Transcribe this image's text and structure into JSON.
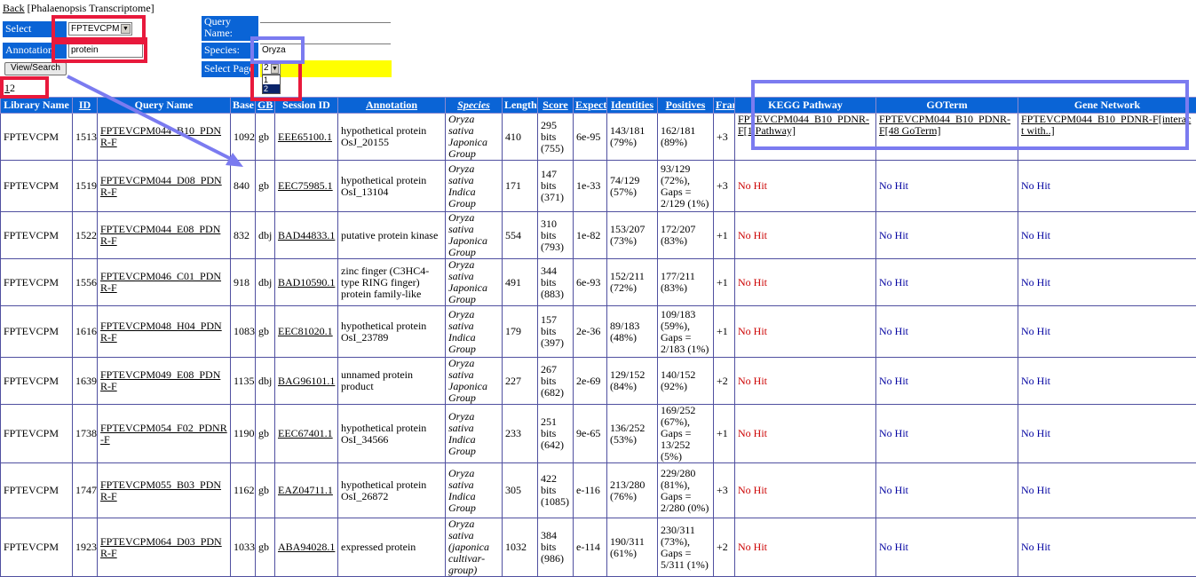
{
  "header": {
    "back_link": "Back",
    "context": "[Phalaenopsis Transcriptome]"
  },
  "form": {
    "library_label": "Select Library",
    "library_value": "FPTEVCPM",
    "annotation_label": "Annotation",
    "annotation_value": "protein",
    "view_button": "View/Search",
    "query_label": "Query Name:",
    "query_value": "",
    "species_label": "Species:",
    "species_value": "Oryza",
    "page_label": "Select Page",
    "page_value": "2",
    "page_options": [
      "1",
      "2"
    ]
  },
  "pager": {
    "page1": "1",
    "page2": "2"
  },
  "columns": [
    "Library Name",
    "ID",
    "Query Name",
    "Base",
    "GB",
    "Session ID",
    "Annotation",
    "Species",
    "Length",
    "Score",
    "Expect",
    "Identities",
    "Positives",
    "Frame",
    "KEGG Pathway",
    "GOTerm",
    "Gene Network"
  ],
  "rows": [
    {
      "lib": "FPTEVCPM",
      "id": "1513",
      "query": "FPTEVCPM044_B10_PDNR-F",
      "base": "1092",
      "gb": "gb",
      "session": "EEE65100.1",
      "annotation": "hypothetical protein OsJ_20155",
      "species": "Oryza sativa Japonica Group",
      "length": "410",
      "score": "295 bits (755)",
      "expect": "6e-95",
      "identities": "143/181 (79%)",
      "positives": "162/181 (89%)",
      "frame": "+3",
      "kegg": "FPTEVCPM044_B10_PDNR-F[1 Pathway]",
      "goterm": "FPTEVCPM044_B10_PDNR-F[48 GoTerm]",
      "network": "FPTEVCPM044_B10_PDNR-F[interact with..]"
    },
    {
      "lib": "FPTEVCPM",
      "id": "1519",
      "query": "FPTEVCPM044_D08_PDNR-F",
      "base": "840",
      "gb": "gb",
      "session": "EEC75985.1",
      "annotation": "hypothetical protein OsI_13104",
      "species": "Oryza sativa Indica Group",
      "length": "171",
      "score": "147 bits (371)",
      "expect": "1e-33",
      "identities": "74/129 (57%)",
      "positives": "93/129 (72%), Gaps = 2/129 (1%)",
      "frame": "+3",
      "kegg": "No Hit",
      "goterm": "No Hit",
      "network": "No Hit"
    },
    {
      "lib": "FPTEVCPM",
      "id": "1522",
      "query": "FPTEVCPM044_E08_PDNR-F",
      "base": "832",
      "gb": "dbj",
      "session": "BAD44833.1",
      "annotation": "putative protein kinase",
      "species": "Oryza sativa Japonica Group",
      "length": "554",
      "score": "310 bits (793)",
      "expect": "1e-82",
      "identities": "153/207 (73%)",
      "positives": "172/207 (83%)",
      "frame": "+1",
      "kegg": "No Hit",
      "goterm": "No Hit",
      "network": "No Hit"
    },
    {
      "lib": "FPTEVCPM",
      "id": "1556",
      "query": "FPTEVCPM046_C01_PDNR-F",
      "base": "918",
      "gb": "dbj",
      "session": "BAD10590.1",
      "annotation": "zinc finger (C3HC4-type RING finger) protein family-like",
      "species": "Oryza sativa Japonica Group",
      "length": "491",
      "score": "344 bits (883)",
      "expect": "6e-93",
      "identities": "152/211 (72%)",
      "positives": "177/211 (83%)",
      "frame": "+1",
      "kegg": "No Hit",
      "goterm": "No Hit",
      "network": "No Hit"
    },
    {
      "lib": "FPTEVCPM",
      "id": "1616",
      "query": "FPTEVCPM048_H04_PDNR-F",
      "base": "1083",
      "gb": "gb",
      "session": "EEC81020.1",
      "annotation": "hypothetical protein OsI_23789",
      "species": "Oryza sativa Indica Group",
      "length": "179",
      "score": "157 bits (397)",
      "expect": "2e-36",
      "identities": "89/183 (48%)",
      "positives": "109/183 (59%), Gaps = 2/183 (1%)",
      "frame": "+1",
      "kegg": "No Hit",
      "goterm": "No Hit",
      "network": "No Hit"
    },
    {
      "lib": "FPTEVCPM",
      "id": "1639",
      "query": "FPTEVCPM049_E08_PDNR-F",
      "base": "1135",
      "gb": "dbj",
      "session": "BAG96101.1",
      "annotation": "unnamed protein product",
      "species": "Oryza sativa Japonica Group",
      "length": "227",
      "score": "267 bits (682)",
      "expect": "2e-69",
      "identities": "129/152 (84%)",
      "positives": "140/152 (92%)",
      "frame": "+2",
      "kegg": "No Hit",
      "goterm": "No Hit",
      "network": "No Hit"
    },
    {
      "lib": "FPTEVCPM",
      "id": "1738",
      "query": "FPTEVCPM054_F02_PDNR-F",
      "base": "1190",
      "gb": "gb",
      "session": "EEC67401.1",
      "annotation": "hypothetical protein OsI_34566",
      "species": "Oryza sativa Indica Group",
      "length": "233",
      "score": "251 bits (642)",
      "expect": "9e-65",
      "identities": "136/252 (53%)",
      "positives": "169/252 (67%), Gaps = 13/252 (5%)",
      "frame": "+1",
      "kegg": "No Hit",
      "goterm": "No Hit",
      "network": "No Hit"
    },
    {
      "lib": "FPTEVCPM",
      "id": "1747",
      "query": "FPTEVCPM055_B03_PDNR-F",
      "base": "1162",
      "gb": "gb",
      "session": "EAZ04711.1",
      "annotation": "hypothetical protein OsI_26872",
      "species": "Oryza sativa Indica Group",
      "length": "305",
      "score": "422 bits (1085)",
      "expect": "e-116",
      "identities": "213/280 (76%)",
      "positives": "229/280 (81%), Gaps = 2/280 (0%)",
      "frame": "+3",
      "kegg": "No Hit",
      "goterm": "No Hit",
      "network": "No Hit"
    },
    {
      "lib": "FPTEVCPM",
      "id": "1923",
      "query": "FPTEVCPM064_D03_PDNR-F",
      "base": "1033",
      "gb": "gb",
      "session": "ABA94028.1",
      "annotation": "expressed protein",
      "species": "Oryza sativa (japonica cultivar-group)",
      "length": "1032",
      "score": "384 bits (986)",
      "expect": "e-114",
      "identities": "190/311 (61%)",
      "positives": "230/311 (73%), Gaps = 5/311 (1%)",
      "frame": "+2",
      "kegg": "No Hit",
      "goterm": "No Hit",
      "network": "No Hit"
    }
  ],
  "colors": {
    "header_blue": "#0a64d6",
    "highlight_red": "#e8193c",
    "highlight_blue": "#7b7bf0",
    "page_yellow": "#ffff00",
    "nohit_red": "#cc0000",
    "nohit_blue": "#0000a0"
  }
}
